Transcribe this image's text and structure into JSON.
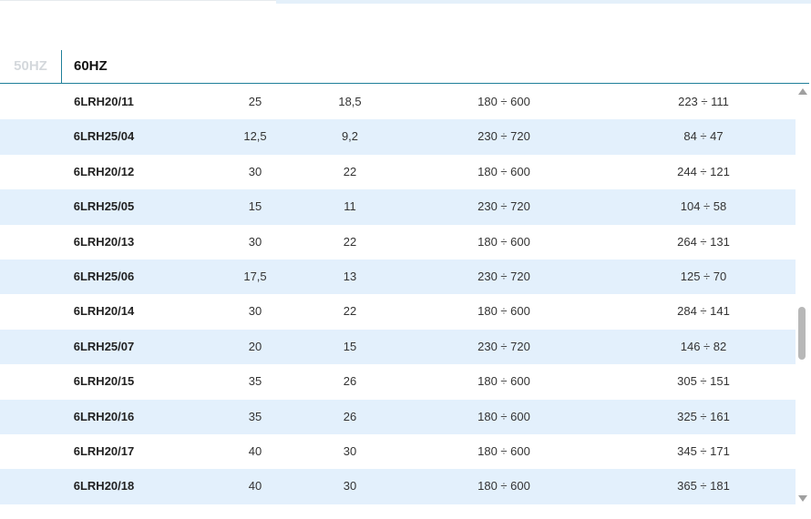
{
  "tabs": {
    "hz50": "50HZ",
    "hz60": "60HZ"
  },
  "rows": [
    {
      "model": "6LRH20/11",
      "v1": "25",
      "v2": "18,5",
      "v3": "180 ÷ 600",
      "v4": "223 ÷ 111"
    },
    {
      "model": "6LRH25/04",
      "v1": "12,5",
      "v2": "9,2",
      "v3": "230 ÷ 720",
      "v4": "84 ÷ 47"
    },
    {
      "model": "6LRH20/12",
      "v1": "30",
      "v2": "22",
      "v3": "180 ÷ 600",
      "v4": "244 ÷ 121"
    },
    {
      "model": "6LRH25/05",
      "v1": "15",
      "v2": "11",
      "v3": "230 ÷ 720",
      "v4": "104 ÷ 58"
    },
    {
      "model": "6LRH20/13",
      "v1": "30",
      "v2": "22",
      "v3": "180 ÷ 600",
      "v4": "264 ÷ 131"
    },
    {
      "model": "6LRH25/06",
      "v1": "17,5",
      "v2": "13",
      "v3": "230 ÷ 720",
      "v4": "125 ÷ 70"
    },
    {
      "model": "6LRH20/14",
      "v1": "30",
      "v2": "22",
      "v3": "180 ÷ 600",
      "v4": "284 ÷ 141"
    },
    {
      "model": "6LRH25/07",
      "v1": "20",
      "v2": "15",
      "v3": "230 ÷ 720",
      "v4": "146 ÷ 82"
    },
    {
      "model": "6LRH20/15",
      "v1": "35",
      "v2": "26",
      "v3": "180 ÷ 600",
      "v4": "305 ÷ 151"
    },
    {
      "model": "6LRH20/16",
      "v1": "35",
      "v2": "26",
      "v3": "180 ÷ 600",
      "v4": "325 ÷ 161"
    },
    {
      "model": "6LRH20/17",
      "v1": "40",
      "v2": "30",
      "v3": "180 ÷ 600",
      "v4": "345 ÷ 171"
    },
    {
      "model": "6LRH20/18",
      "v1": "40",
      "v2": "30",
      "v3": "180 ÷ 600",
      "v4": "365 ÷ 181"
    }
  ],
  "colors": {
    "row_alt": "#e3f0fc",
    "tab_divider": "#1f7f9a",
    "tab_inactive": "#d4d8dc"
  },
  "icons": {
    "scroll_up": "triangle-up-icon",
    "scroll_down": "triangle-down-icon"
  }
}
